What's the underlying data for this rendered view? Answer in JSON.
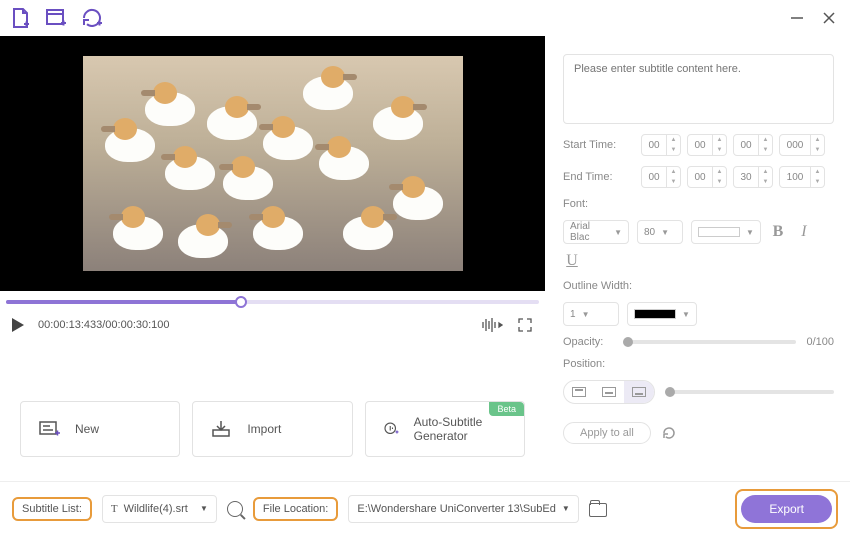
{
  "topbar_icons": [
    "new-file-icon",
    "new-tab-icon",
    "rotate-add-icon"
  ],
  "video": {
    "current_time": "00:00:13:433",
    "total_time": "00:00:30:100"
  },
  "actions": {
    "new": "New",
    "import": "Import",
    "auto": "Auto-Subtitle Generator",
    "beta": "Beta"
  },
  "panel": {
    "placeholder": "Please enter subtitle content here.",
    "start_label": "Start Time:",
    "end_label": "End Time:",
    "start": {
      "h": "00",
      "m": "00",
      "s": "00",
      "ms": "000"
    },
    "end": {
      "h": "00",
      "m": "00",
      "s": "30",
      "ms": "100"
    },
    "font_label": "Font:",
    "font_name": "Arial Blac",
    "font_size": "80",
    "outline_label": "Outline Width:",
    "outline_width": "1",
    "opacity_label": "Opacity:",
    "opacity_value": "0/100",
    "position_label": "Position:",
    "apply_label": "Apply to all"
  },
  "footer": {
    "subtitle_list_label": "Subtitle List:",
    "subtitle_file": "Wildlife(4).srt",
    "file_location_label": "File Location:",
    "file_location": "E:\\Wondershare UniConverter 13\\SubEd",
    "export": "Export"
  }
}
